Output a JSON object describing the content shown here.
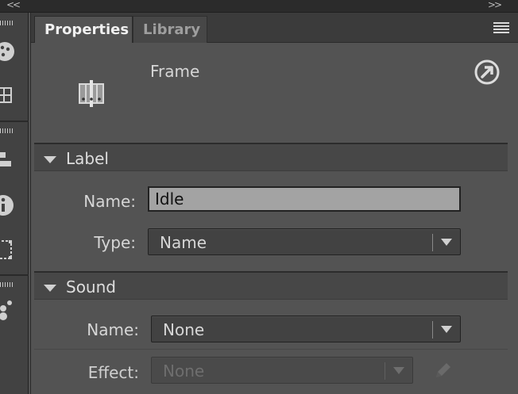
{
  "toolbar_strip": {
    "collapse_left": "<<",
    "collapse_right": ">>",
    "tools": [
      "palette-icon",
      "grid-icon",
      "align-icon",
      "info-icon",
      "transform-icon",
      "components-icon"
    ]
  },
  "tabs": [
    {
      "label": "Properties",
      "active": true
    },
    {
      "label": "Library",
      "active": false
    }
  ],
  "header": {
    "object_type": "Frame",
    "icon": "frame-icon",
    "goto_icon": "goto-arrow-icon"
  },
  "label_section": {
    "title": "Label",
    "name_label": "Name:",
    "name_value": "Idle",
    "type_label": "Type:",
    "type_value": "Name"
  },
  "sound_section": {
    "title": "Sound",
    "name_label": "Name:",
    "name_value": "None",
    "effect_label": "Effect:",
    "effect_value": "None",
    "effect_disabled": true
  },
  "colors": {
    "panel_bg": "#535353",
    "tabbar_bg": "#3b3b3b",
    "section_bg": "#474747",
    "input_bg": "#a3a3a3"
  }
}
